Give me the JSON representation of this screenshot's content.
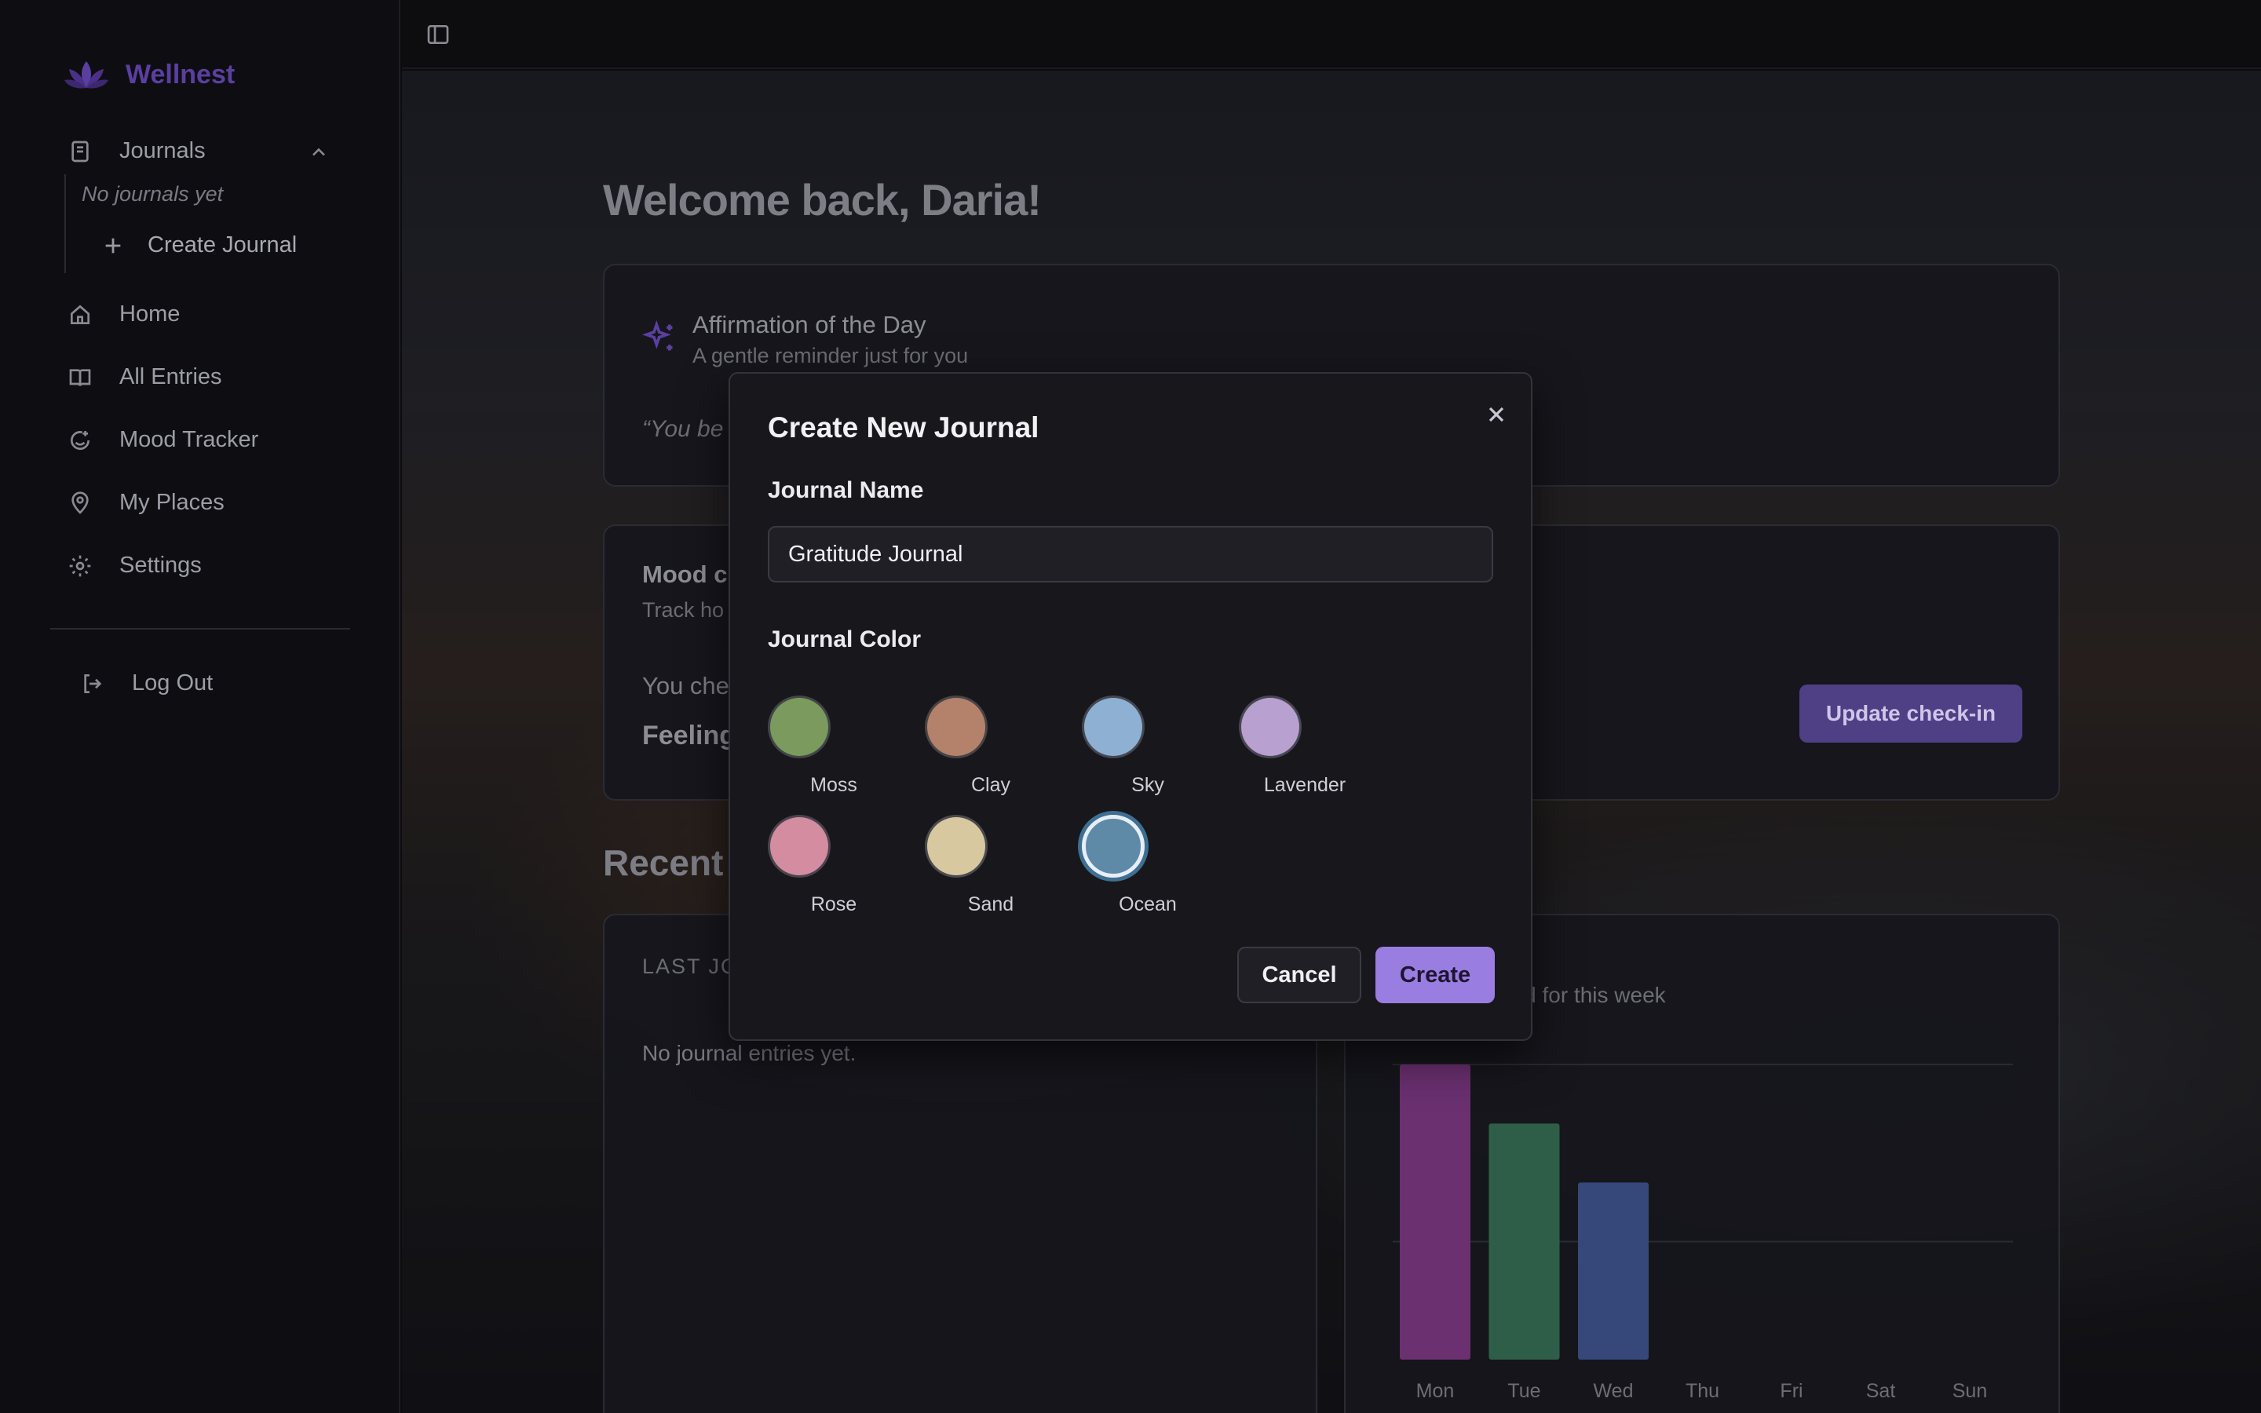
{
  "app": {
    "name": "Wellnest",
    "brand_color": "#5b3fa0"
  },
  "sidebar": {
    "journals_label": "Journals",
    "no_journals": "No journals yet",
    "create_journal": "Create Journal",
    "items": [
      {
        "label": "Home",
        "icon": "home-icon"
      },
      {
        "label": "All Entries",
        "icon": "book-open-icon"
      },
      {
        "label": "Mood Tracker",
        "icon": "smile-plus-icon"
      },
      {
        "label": "My Places",
        "icon": "map-pin-icon"
      },
      {
        "label": "Settings",
        "icon": "gear-icon"
      }
    ],
    "logout": "Log Out"
  },
  "main": {
    "welcome": "Welcome back, Daria!",
    "affirmation": {
      "title": "Affirmation of the Day",
      "subtitle": "A gentle reminder just for you",
      "quote_visible": "“You be"
    },
    "mood": {
      "title_visible": "Mood c",
      "subtitle_visible": "Track ho",
      "checked_visible": "You che",
      "feeling_visible": "Feeling",
      "update_button": "Update check-in"
    },
    "recent_heading_visible": "Recent",
    "entries": {
      "label_visible": "LAST JO",
      "empty": "No journal entries yet."
    },
    "chart": {
      "subtitle_visible": "ood for this week"
    }
  },
  "modal": {
    "title": "Create New Journal",
    "name_label": "Journal Name",
    "name_value": "Gratitude Journal",
    "color_label": "Journal Color",
    "colors": [
      {
        "name": "Moss",
        "hex": "#7a9a5e"
      },
      {
        "name": "Clay",
        "hex": "#b4826a"
      },
      {
        "name": "Sky",
        "hex": "#8eb0d2"
      },
      {
        "name": "Lavender",
        "hex": "#b8a0d0"
      },
      {
        "name": "Rose",
        "hex": "#d48ca0"
      },
      {
        "name": "Sand",
        "hex": "#d8c8a0"
      },
      {
        "name": "Ocean",
        "hex": "#5e8aa8"
      }
    ],
    "selected_color": "Ocean",
    "cancel": "Cancel",
    "create": "Create"
  },
  "chart_data": {
    "type": "bar",
    "categories": [
      "Mon",
      "Tue",
      "Wed",
      "Thu",
      "Fri",
      "Sat",
      "Sun"
    ],
    "values": [
      5,
      4,
      3,
      null,
      null,
      null,
      null
    ],
    "colors": [
      "#6a3070",
      "#2f5e48",
      "#36477a"
    ],
    "ylim": [
      0,
      5
    ],
    "grid": true
  }
}
